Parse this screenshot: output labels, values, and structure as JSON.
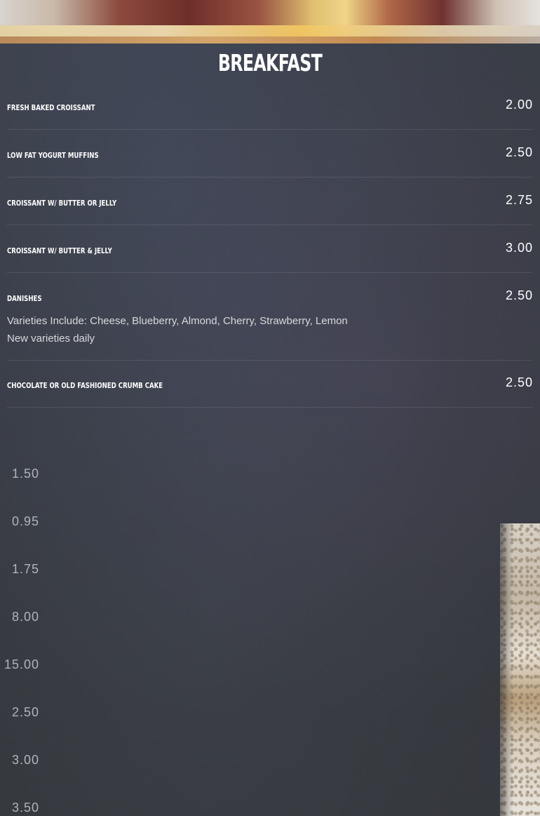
{
  "section": {
    "title": "BREAKFAST"
  },
  "items": [
    {
      "name": "FRESH BAKED CROISSANT",
      "price": "2.00"
    },
    {
      "name": "LOW FAT YOGURT MUFFINS",
      "price": "2.50"
    },
    {
      "name": "CROISSANT W/ BUTTER OR JELLY",
      "price": "2.75"
    },
    {
      "name": "CROISSANT W/ BUTTER & JELLY",
      "price": "3.00"
    },
    {
      "name": "DANISHES",
      "price": "2.50",
      "desc1": "Varieties Include: Cheese, Blueberry, Almond, Cherry, Strawberry, Lemon",
      "desc2": "New varieties daily"
    },
    {
      "name": "CHOCOLATE OR OLD FASHIONED CRUMB CAKE",
      "price": "2.50"
    }
  ],
  "next_section_prices": [
    "1.50",
    "0.95",
    "1.75",
    "8.00",
    "15.00",
    "2.50",
    "3.00",
    "3.50"
  ]
}
